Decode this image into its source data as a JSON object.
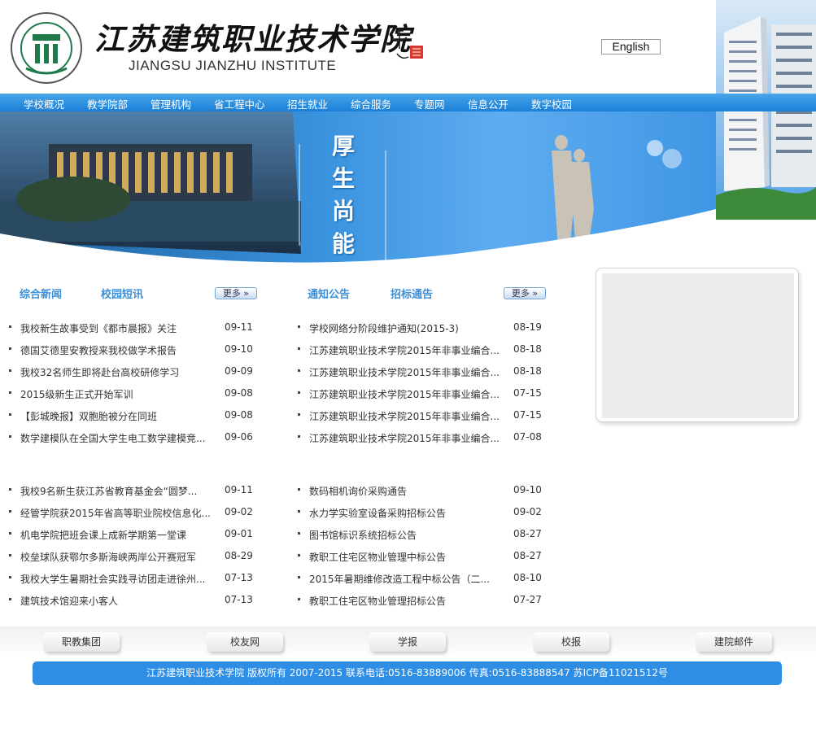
{
  "header": {
    "school_name_cn": "江苏建筑职业技术学院",
    "school_name_en": "JIANGSU JIANZHU INSTITUTE",
    "logo_text": "江苏建筑职业技术学院 JIANGSU JIANZHU INSTITUTE",
    "english_label": "English"
  },
  "nav": {
    "items": [
      "学校概况",
      "教学院部",
      "管理机构",
      "省工程中心",
      "招生就业",
      "综合服务",
      "专题网",
      "信息公开",
      "数字校园"
    ]
  },
  "banner": {
    "motto": "厚生尚能"
  },
  "left_section": {
    "tabs": [
      "综合新闻",
      "校园短讯"
    ],
    "more_label": "更多",
    "news": [
      {
        "title": "我校新生故事受到《都市晨报》关注",
        "date": "09-11"
      },
      {
        "title": "德国艾德里安教授来我校做学术报告",
        "date": "09-10"
      },
      {
        "title": "我校32名师生即将赴台高校研修学习",
        "date": "09-09"
      },
      {
        "title": "2015级新生正式开始军训",
        "date": "09-08"
      },
      {
        "title": "【彭城晚报】双胞胎被分在同班",
        "date": "09-08"
      },
      {
        "title": "数学建模队在全国大学生电工数学建模竞...",
        "date": "09-06"
      }
    ],
    "news2": [
      {
        "title": "我校9名新生获江苏省教育基金会“圆梦...",
        "date": "09-11"
      },
      {
        "title": "经管学院获2015年省高等职业院校信息化...",
        "date": "09-02"
      },
      {
        "title": "机电学院把班会课上成新学期第一堂课",
        "date": "09-01"
      },
      {
        "title": "校垒球队获鄂尔多斯海峡两岸公开赛冠军",
        "date": "08-29"
      },
      {
        "title": "我校大学生暑期社会实践寻访团走进徐州...",
        "date": "07-13"
      },
      {
        "title": "建筑技术馆迎来小客人",
        "date": "07-13"
      }
    ]
  },
  "right_section": {
    "tabs": [
      "通知公告",
      "招标通告"
    ],
    "more_label": "更多",
    "notices": [
      {
        "title": "学校网络分阶段维护通知(2015-3)",
        "date": "08-19"
      },
      {
        "title": "江苏建筑职业技术学院2015年非事业编合...",
        "date": "08-18"
      },
      {
        "title": "江苏建筑职业技术学院2015年非事业编合...",
        "date": "08-18"
      },
      {
        "title": "江苏建筑职业技术学院2015年非事业编合...",
        "date": "07-15"
      },
      {
        "title": "江苏建筑职业技术学院2015年非事业编合...",
        "date": "07-15"
      },
      {
        "title": "江苏建筑职业技术学院2015年非事业编合...",
        "date": "07-08"
      }
    ],
    "tenders": [
      {
        "title": "数码相机询价采购通告",
        "date": "09-10"
      },
      {
        "title": "水力学实验室设备采购招标公告",
        "date": "09-02"
      },
      {
        "title": "图书馆标识系统招标公告",
        "date": "08-27"
      },
      {
        "title": "教职工住宅区物业管理中标公告",
        "date": "08-27"
      },
      {
        "title": "2015年暑期维修改造工程中标公告（二...",
        "date": "08-10"
      },
      {
        "title": "教职工住宅区物业管理招标公告",
        "date": "07-27"
      }
    ]
  },
  "footer": {
    "links": [
      "职教集团",
      "校友网",
      "学报",
      "校报",
      "建院邮件"
    ],
    "copyright": "江苏建筑职业技术学院 版权所有 2007-2015 联系电话:0516-83889006 传真:0516-83888547 苏ICP备11021512号"
  },
  "colors": {
    "nav_blue": "#1a7fd6",
    "accent_blue": "#2e8ee6",
    "tab_blue": "#3c8fd8",
    "logo_green": "#1f7a4a"
  }
}
